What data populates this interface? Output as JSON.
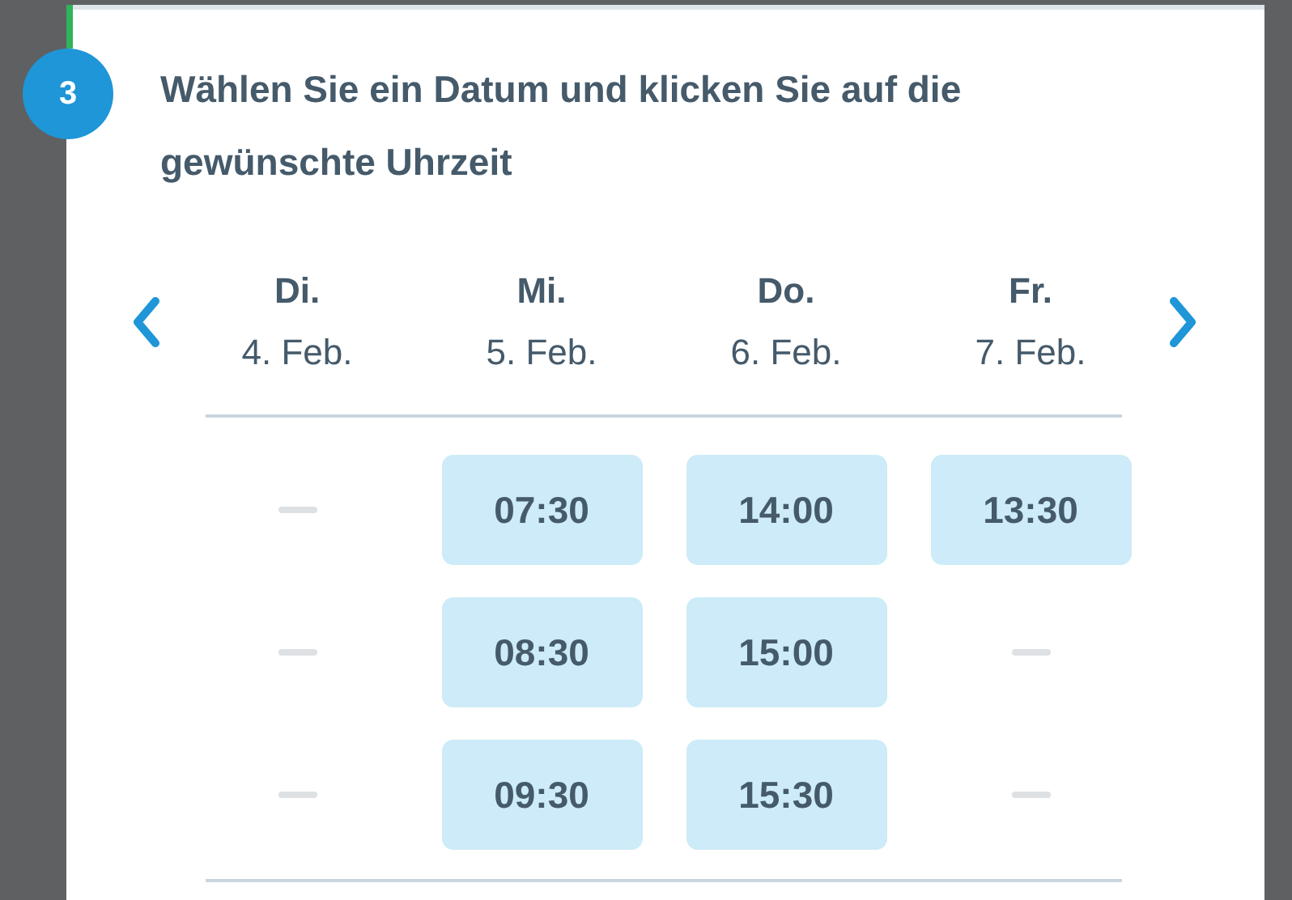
{
  "step": {
    "number": "3",
    "title": "Wählen Sie ein Datum und klicken Sie auf die gewünschte Uhrzeit"
  },
  "days": [
    {
      "weekday": "Di.",
      "date": "4. Feb.",
      "slots": [
        {
          "kind": "empty"
        },
        {
          "kind": "empty"
        },
        {
          "kind": "empty"
        }
      ]
    },
    {
      "weekday": "Mi.",
      "date": "5. Feb.",
      "slots": [
        {
          "kind": "time",
          "time": "07:30"
        },
        {
          "kind": "time",
          "time": "08:30"
        },
        {
          "kind": "time",
          "time": "09:30"
        }
      ]
    },
    {
      "weekday": "Do.",
      "date": "6. Feb.",
      "slots": [
        {
          "kind": "time",
          "time": "14:00"
        },
        {
          "kind": "time",
          "time": "15:00"
        },
        {
          "kind": "time",
          "time": "15:30"
        }
      ]
    },
    {
      "weekday": "Fr.",
      "date": "7. Feb.",
      "slots": [
        {
          "kind": "time",
          "time": "13:30"
        },
        {
          "kind": "empty"
        },
        {
          "kind": "empty"
        }
      ]
    }
  ]
}
